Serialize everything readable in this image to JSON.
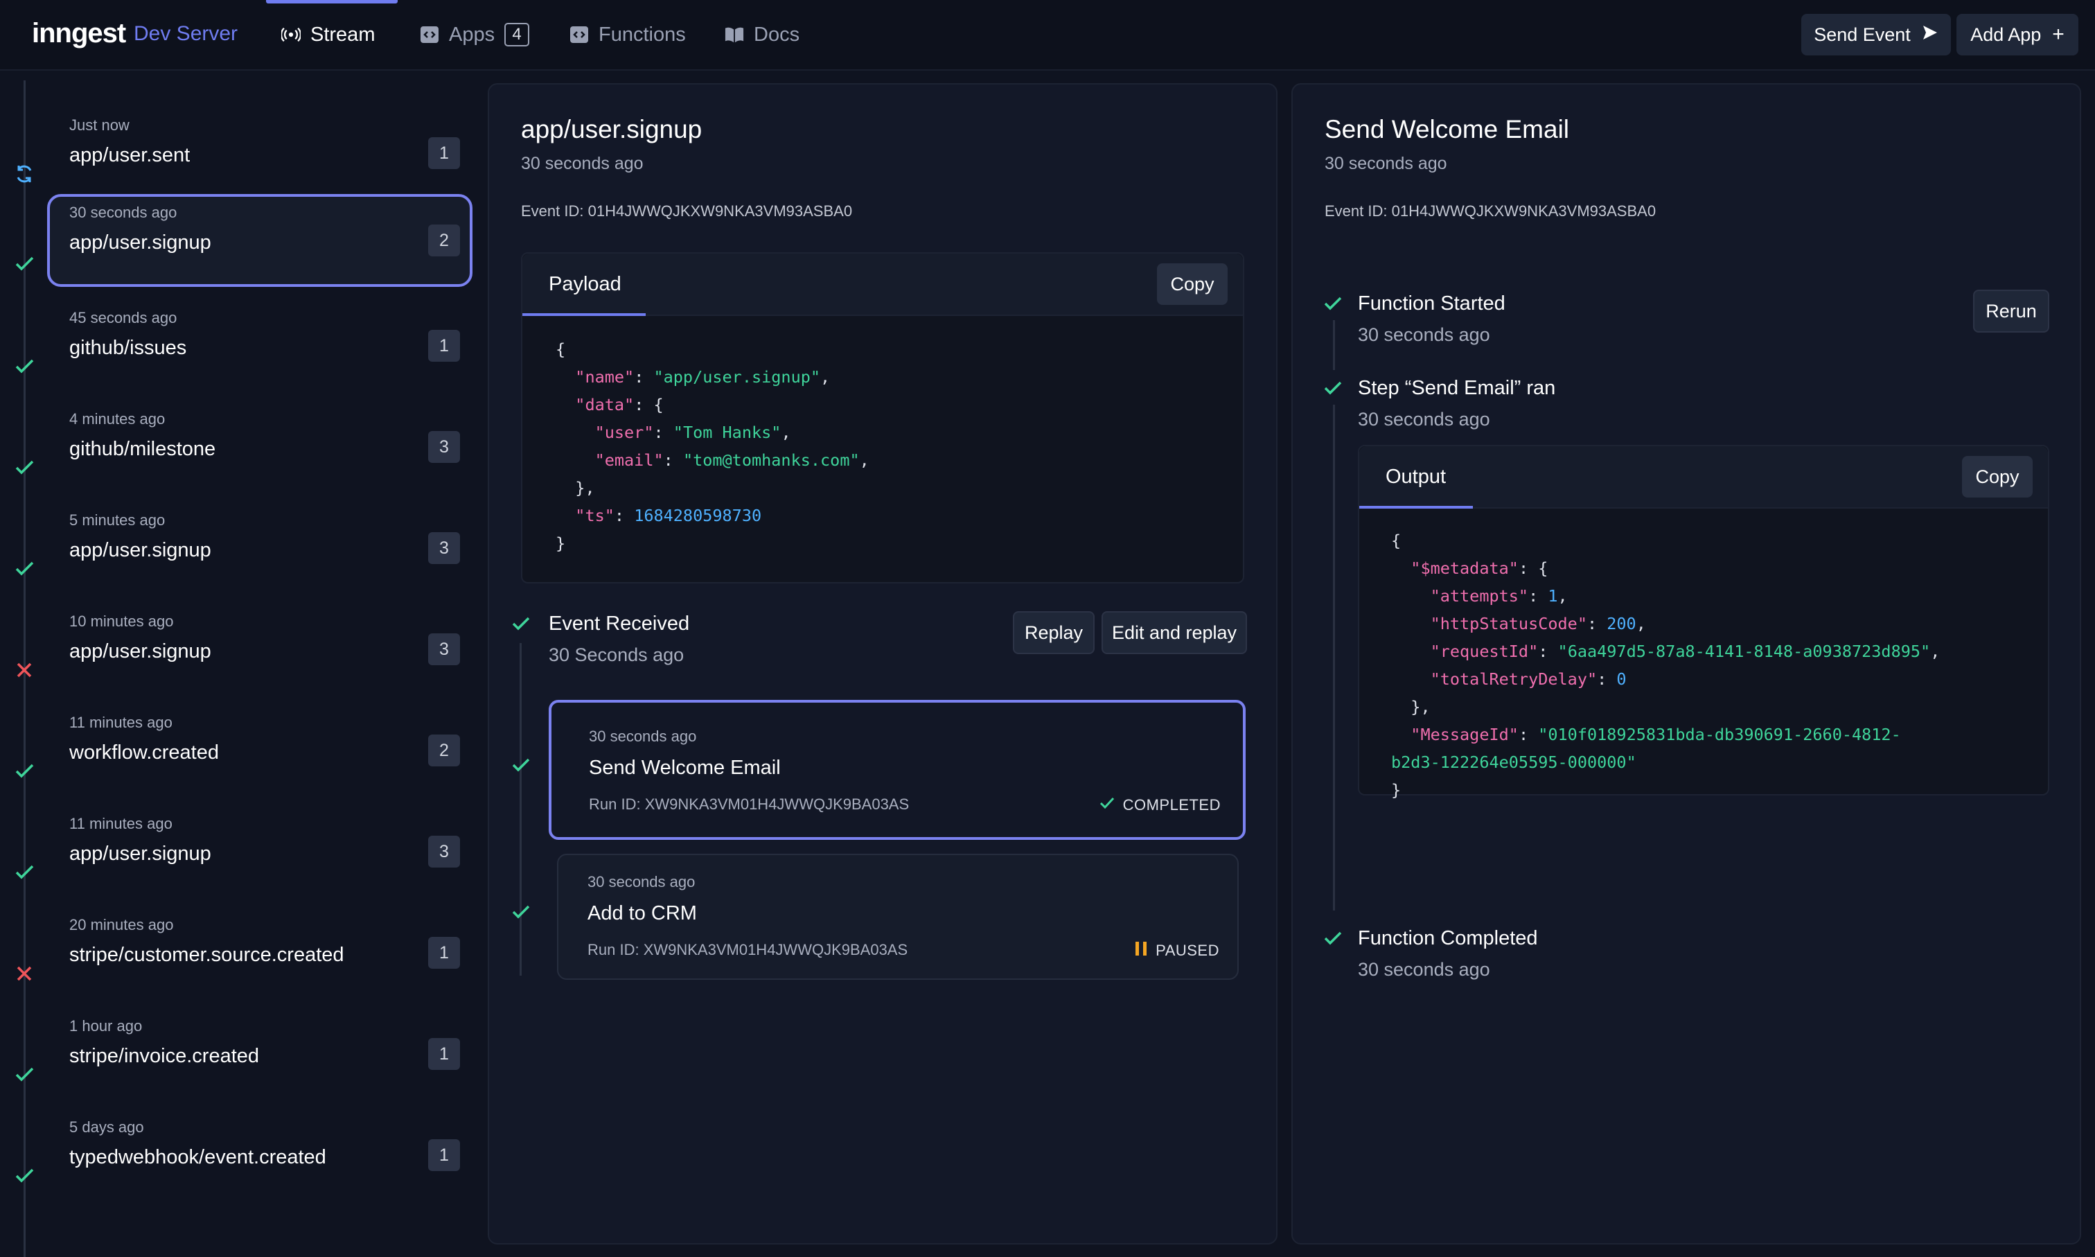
{
  "app": {
    "logo": "inngest",
    "subtitle": "Dev Server"
  },
  "nav": {
    "tabs": [
      {
        "label": "Stream",
        "icon": "broadcast-icon",
        "active": true
      },
      {
        "label": "Apps",
        "icon": "code-icon",
        "badge": "4"
      },
      {
        "label": "Functions",
        "icon": "code-icon"
      },
      {
        "label": "Docs",
        "icon": "book-icon"
      }
    ],
    "send_event": "Send Event",
    "add_app": "Add App"
  },
  "events": [
    {
      "time": "Just now",
      "name": "app/user.sent",
      "count": "1",
      "status": "running"
    },
    {
      "time": "30 seconds ago",
      "name": "app/user.signup",
      "count": "2",
      "status": "success",
      "selected": true
    },
    {
      "time": "45 seconds ago",
      "name": "github/issues",
      "count": "1",
      "status": "success"
    },
    {
      "time": "4 minutes ago",
      "name": "github/milestone",
      "count": "3",
      "status": "success"
    },
    {
      "time": "5 minutes ago",
      "name": "app/user.signup",
      "count": "3",
      "status": "success"
    },
    {
      "time": "10 minutes ago",
      "name": "app/user.signup",
      "count": "3",
      "status": "failed"
    },
    {
      "time": "11 minutes ago",
      "name": "workflow.created",
      "count": "2",
      "status": "success"
    },
    {
      "time": "11 minutes ago",
      "name": "app/user.signup",
      "count": "3",
      "status": "success"
    },
    {
      "time": "20 minutes ago",
      "name": "stripe/customer.source.created",
      "count": "1",
      "status": "failed"
    },
    {
      "time": "1 hour ago",
      "name": "stripe/invoice.created",
      "count": "1",
      "status": "success"
    },
    {
      "time": "5 days ago",
      "name": "typedwebhook/event.created",
      "count": "1",
      "status": "success"
    }
  ],
  "event_panel": {
    "title": "app/user.signup",
    "time": "30 seconds ago",
    "event_id": "Event ID: 01H4JWWQJKXW9NKA3VM93ASBA0",
    "payload_tab": "Payload",
    "copy": "Copy",
    "payload": {
      "name": "app/user.signup",
      "user": "Tom Hanks",
      "email": "tom@tomhanks.com",
      "ts": "1684280598730"
    },
    "received_title": "Event Received",
    "received_time": "30 Seconds ago",
    "replay": "Replay",
    "edit_replay": "Edit and replay",
    "runs": [
      {
        "time": "30 seconds ago",
        "name": "Send Welcome Email",
        "run_id": "Run ID: XW9NKA3VM01H4JWWQJK9BA03AS",
        "status": "COMPLETED",
        "selected": true
      },
      {
        "time": "30 seconds ago",
        "name": "Add to CRM",
        "run_id": "Run ID: XW9NKA3VM01H4JWWQJK9BA03AS",
        "status": "PAUSED"
      }
    ]
  },
  "run_panel": {
    "title": "Send Welcome Email",
    "time": "30 seconds ago",
    "event_id": "Event ID: 01H4JWWQJKXW9NKA3VM93ASBA0",
    "rerun": "Rerun",
    "steps": [
      {
        "title": "Function Started",
        "time": "30 seconds ago"
      },
      {
        "title": "Step “Send Email” ran",
        "time": "30 seconds ago"
      },
      {
        "title": "Function Completed",
        "time": "30 seconds ago"
      }
    ],
    "output_tab": "Output",
    "copy": "Copy",
    "output": {
      "attempts": "1",
      "httpStatusCode": "200",
      "requestId": "6aa497d5-87a8-4141-8148-a0938723d895",
      "totalRetryDelay": "0",
      "MessageId_1": "010f018925831bda-db390691-2660-4812-",
      "MessageId_2": "b2d3-122264e05595-000000"
    }
  },
  "colors": {
    "accent": "#6f7cf0",
    "success": "#3fd59b",
    "error": "#f0555a",
    "paused": "#f5a623"
  }
}
